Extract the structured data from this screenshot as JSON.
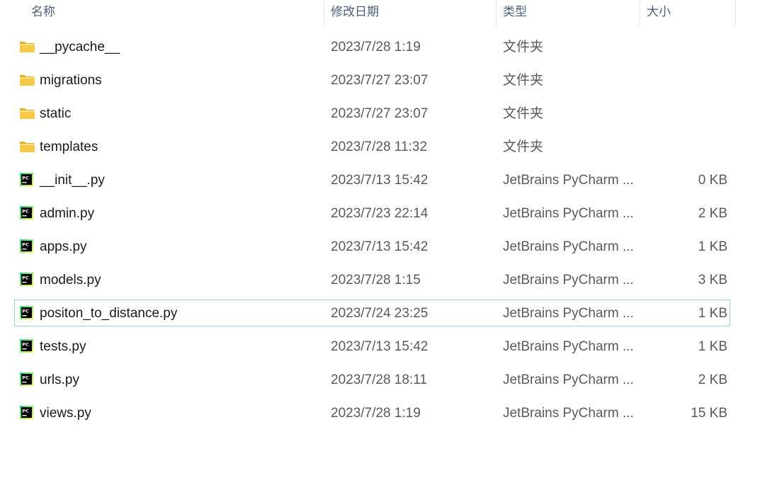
{
  "columns": {
    "name": "名称",
    "date": "修改日期",
    "type": "类型",
    "size": "大小",
    "sort_indicator": "^"
  },
  "colors": {
    "folder_body": "#f7c948",
    "folder_tab": "#e8ad1f",
    "pycharm_bg": "#000000",
    "pycharm_border_green": "#21d789",
    "pycharm_border_yellow": "#fcf84a",
    "selection_border": "#99d1e4",
    "header_text": "#4c607a"
  },
  "files": [
    {
      "icon": "folder-icon",
      "name": "__pycache__",
      "date": "2023/7/28 1:19",
      "type": "文件夹",
      "size": ""
    },
    {
      "icon": "folder-icon",
      "name": "migrations",
      "date": "2023/7/27 23:07",
      "type": "文件夹",
      "size": ""
    },
    {
      "icon": "folder-icon",
      "name": "static",
      "date": "2023/7/27 23:07",
      "type": "文件夹",
      "size": ""
    },
    {
      "icon": "folder-icon",
      "name": "templates",
      "date": "2023/7/28 11:32",
      "type": "文件夹",
      "size": ""
    },
    {
      "icon": "pycharm-file-icon",
      "name": "__init__.py",
      "date": "2023/7/13 15:42",
      "type": "JetBrains PyCharm ...",
      "size": "0 KB"
    },
    {
      "icon": "pycharm-file-icon",
      "name": "admin.py",
      "date": "2023/7/23 22:14",
      "type": "JetBrains PyCharm ...",
      "size": "2 KB"
    },
    {
      "icon": "pycharm-file-icon",
      "name": "apps.py",
      "date": "2023/7/13 15:42",
      "type": "JetBrains PyCharm ...",
      "size": "1 KB"
    },
    {
      "icon": "pycharm-file-icon",
      "name": "models.py",
      "date": "2023/7/28 1:15",
      "type": "JetBrains PyCharm ...",
      "size": "3 KB"
    },
    {
      "icon": "pycharm-file-icon",
      "name": "positon_to_distance.py",
      "date": "2023/7/24 23:25",
      "type": "JetBrains PyCharm ...",
      "size": "1 KB",
      "selected": true
    },
    {
      "icon": "pycharm-file-icon",
      "name": "tests.py",
      "date": "2023/7/13 15:42",
      "type": "JetBrains PyCharm ...",
      "size": "1 KB"
    },
    {
      "icon": "pycharm-file-icon",
      "name": "urls.py",
      "date": "2023/7/28 18:11",
      "type": "JetBrains PyCharm ...",
      "size": "2 KB"
    },
    {
      "icon": "pycharm-file-icon",
      "name": "views.py",
      "date": "2023/7/28 1:19",
      "type": "JetBrains PyCharm ...",
      "size": "15 KB"
    }
  ],
  "pycharm_icon_text": "PC"
}
